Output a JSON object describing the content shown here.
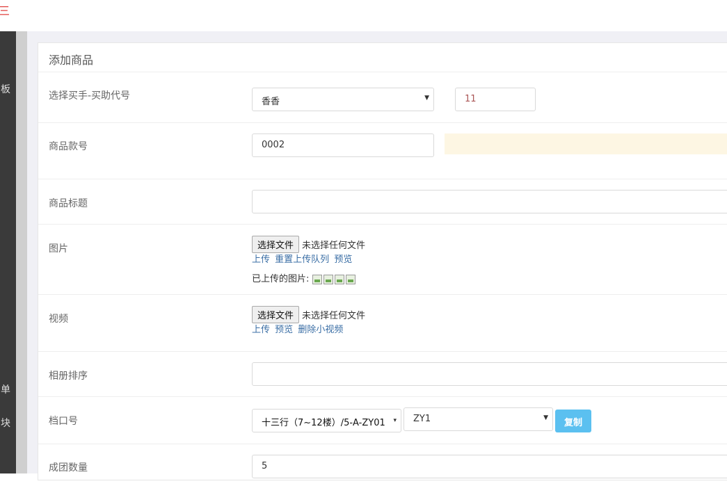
{
  "topbar": {
    "menu_toggle": "三"
  },
  "sidebar": {
    "chars": [
      "板",
      "单",
      "块"
    ]
  },
  "panel": {
    "title": "添加商品"
  },
  "form": {
    "buyer": {
      "label": "选择买手-买助代号",
      "selected": "香香",
      "code": "11"
    },
    "item_no": {
      "label": "商品款号",
      "value": "0002"
    },
    "title": {
      "label": "商品标题",
      "value": ""
    },
    "images": {
      "label": "图片",
      "choose_btn": "选择文件",
      "no_file": "未选择任何文件",
      "links": [
        "上传",
        "重置上传队列",
        "预览"
      ],
      "uploaded_label": "已上传的图片:",
      "uploaded_count": 4
    },
    "video": {
      "label": "视频",
      "choose_btn": "选择文件",
      "no_file": "未选择任何文件",
      "links": [
        "上传",
        "预览",
        "删除小视频"
      ]
    },
    "album_order": {
      "label": "相册排序",
      "value": ""
    },
    "stall": {
      "label": "档口号",
      "market": "十三行（7~12楼）/5-A-ZY01",
      "stall_code": "ZY1",
      "copy_btn": "复制"
    },
    "group_qty": {
      "label": "成团数量",
      "value": "5"
    }
  }
}
